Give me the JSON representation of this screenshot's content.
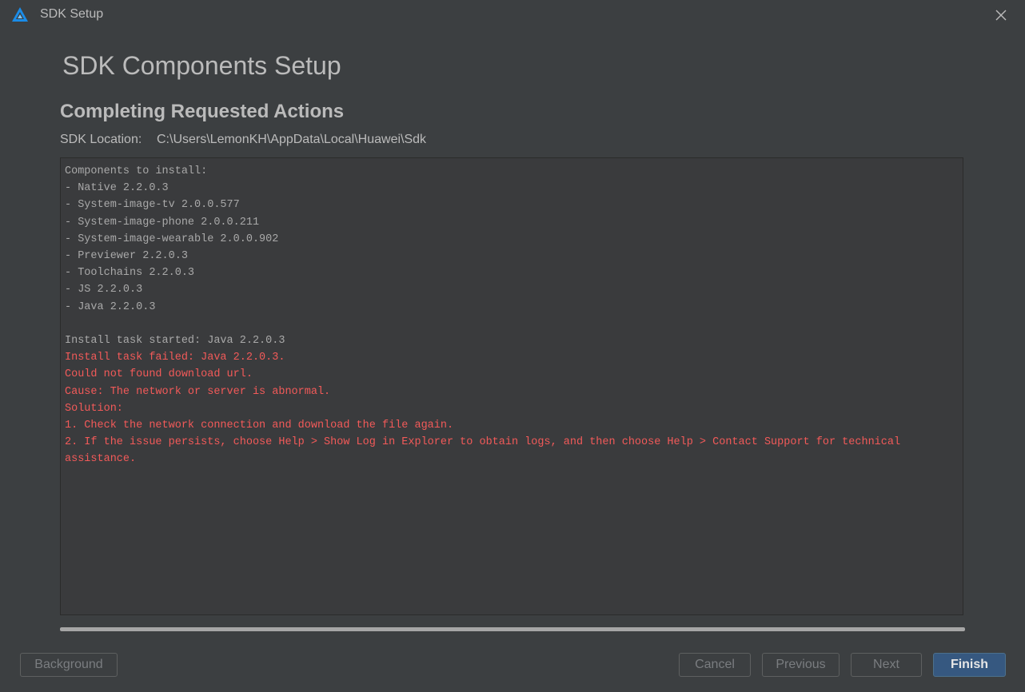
{
  "window": {
    "title": "SDK Setup",
    "icon": "app-logo-icon",
    "close_icon": "close-icon"
  },
  "page": {
    "title": "SDK Components Setup",
    "section_title": "Completing Requested Actions",
    "sdk_location_label": "SDK Location:",
    "sdk_location_path": "C:\\Users\\LemonKH\\AppData\\Local\\Huawei\\Sdk"
  },
  "log": {
    "lines": [
      {
        "text": "Components to install:",
        "kind": "info"
      },
      {
        "text": "- Native 2.2.0.3",
        "kind": "info"
      },
      {
        "text": "- System-image-tv 2.0.0.577",
        "kind": "info"
      },
      {
        "text": "- System-image-phone 2.0.0.211",
        "kind": "info"
      },
      {
        "text": "- System-image-wearable 2.0.0.902",
        "kind": "info"
      },
      {
        "text": "- Previewer 2.2.0.3",
        "kind": "info"
      },
      {
        "text": "- Toolchains 2.2.0.3",
        "kind": "info"
      },
      {
        "text": "- JS 2.2.0.3",
        "kind": "info"
      },
      {
        "text": "- Java 2.2.0.3",
        "kind": "info"
      },
      {
        "text": "",
        "kind": "info"
      },
      {
        "text": "Install task started: Java 2.2.0.3",
        "kind": "info"
      },
      {
        "text": "Install task failed: Java 2.2.0.3.",
        "kind": "error"
      },
      {
        "text": "Could not found download url.",
        "kind": "error"
      },
      {
        "text": "Cause: The network or server is abnormal.",
        "kind": "error"
      },
      {
        "text": "Solution:",
        "kind": "error"
      },
      {
        "text": "1. Check the network connection and download the file again.",
        "kind": "error"
      },
      {
        "text": "2. If the issue persists, choose Help > Show Log in Explorer to obtain logs, and then choose Help > Contact Support for technical assistance.",
        "kind": "error"
      }
    ]
  },
  "progress": {
    "fraction": 1.0
  },
  "buttons": {
    "background": "Background",
    "cancel": "Cancel",
    "previous": "Previous",
    "next": "Next",
    "finish": "Finish"
  },
  "colors": {
    "background": "#3c3f41",
    "error_text": "#f25a59",
    "info_text": "#a9a9a9",
    "primary_button": "#365880",
    "logo_blue": "#1a8ce8"
  }
}
